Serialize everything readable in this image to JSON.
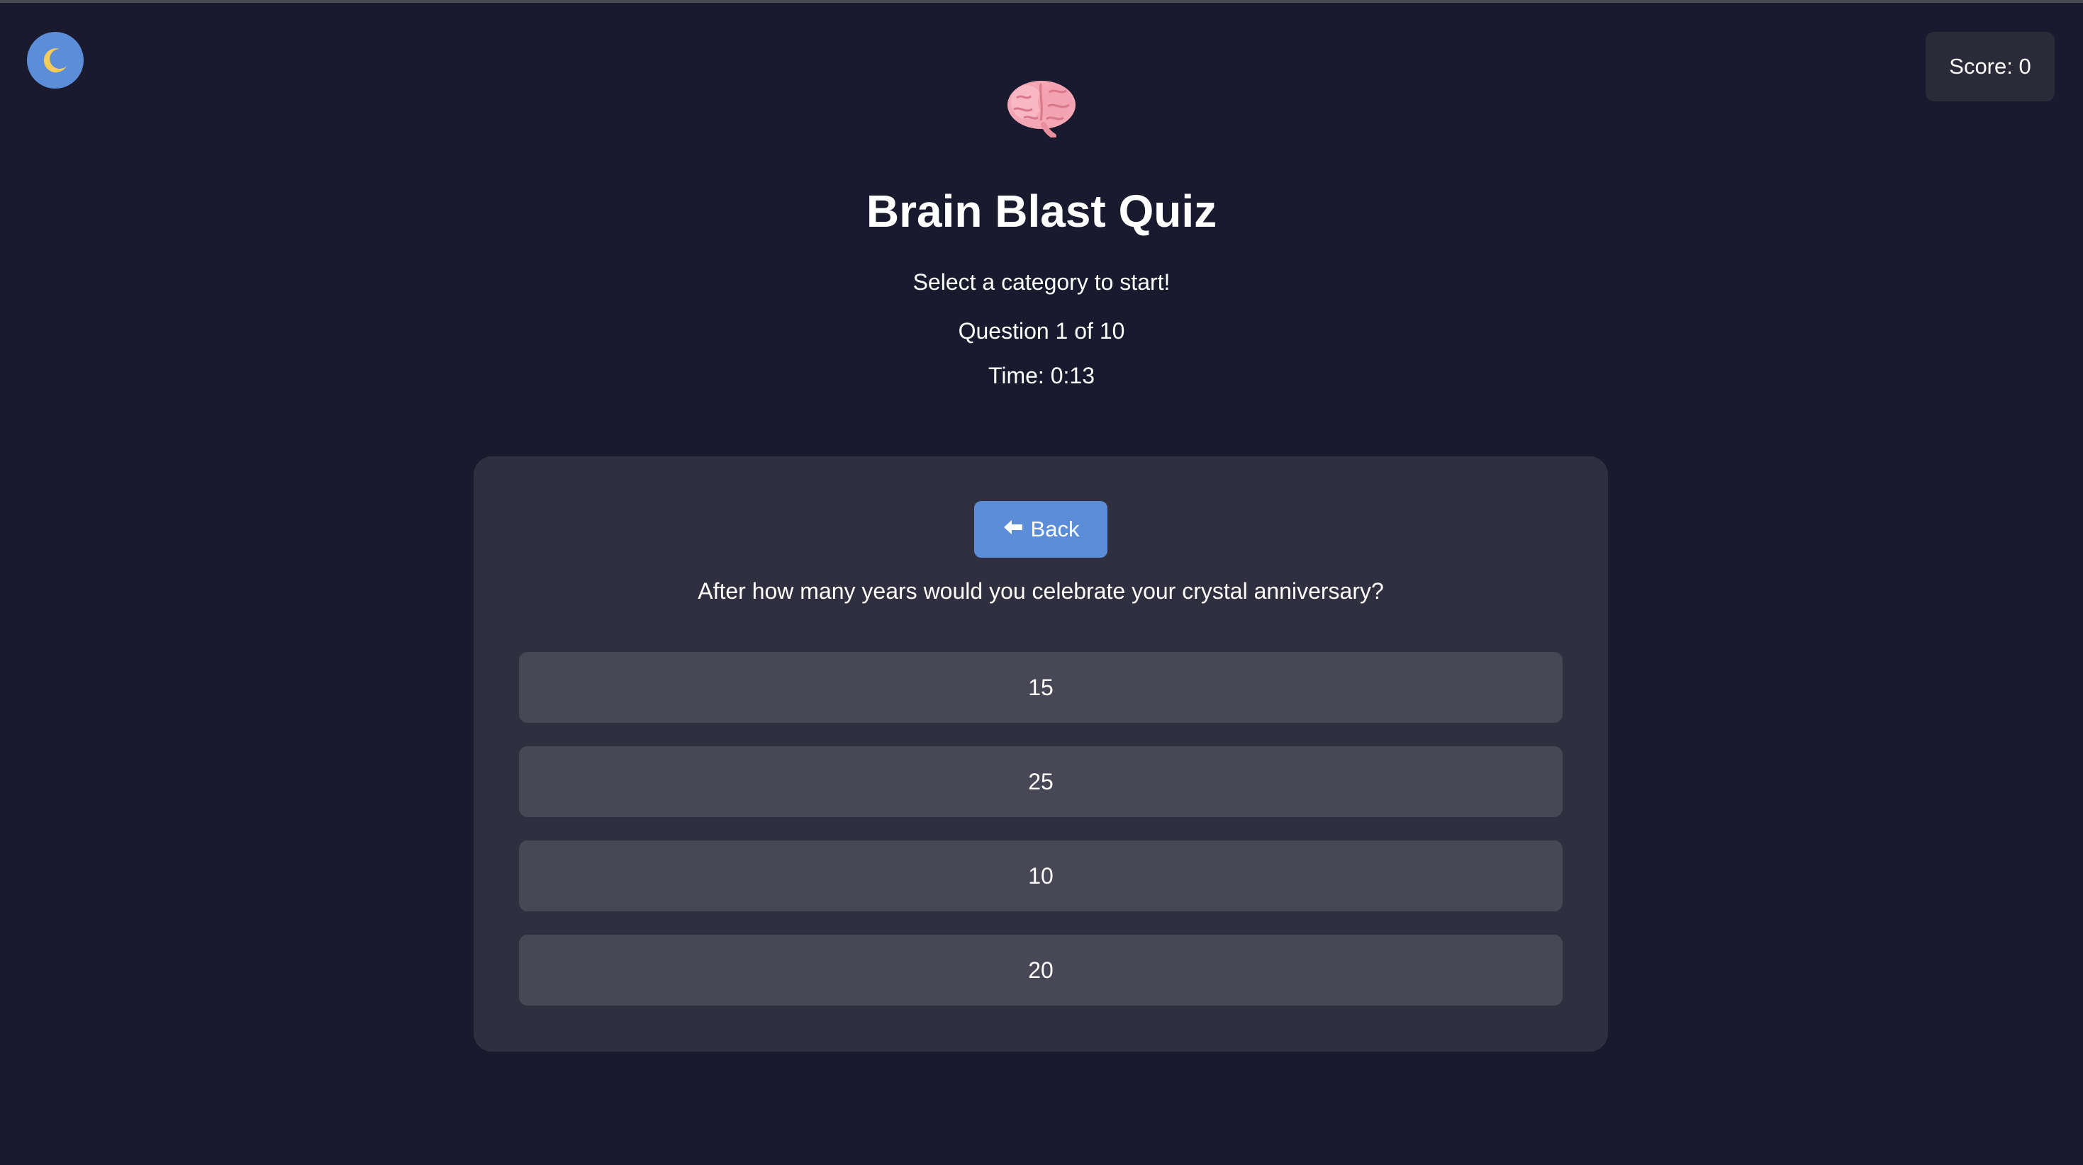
{
  "theme_toggle": {
    "icon": "moon-icon"
  },
  "score": {
    "text": "Score: 0"
  },
  "header": {
    "icon": "brain-icon",
    "title": "Brain Blast Quiz",
    "subtitle": "Select a category to start!",
    "progress": "Question 1 of 10",
    "timer": "Time: 0:13"
  },
  "quiz": {
    "back_label": "Back",
    "back_icon": "arrow-left-icon",
    "question": "After how many years would you celebrate your crystal anniversary?",
    "answers": [
      "15",
      "25",
      "10",
      "20"
    ]
  },
  "colors": {
    "background": "#1a1a2e",
    "card": "#302f3f",
    "answer": "#484756",
    "accent": "#5b8dd9",
    "score_box": "#2b2a39"
  }
}
